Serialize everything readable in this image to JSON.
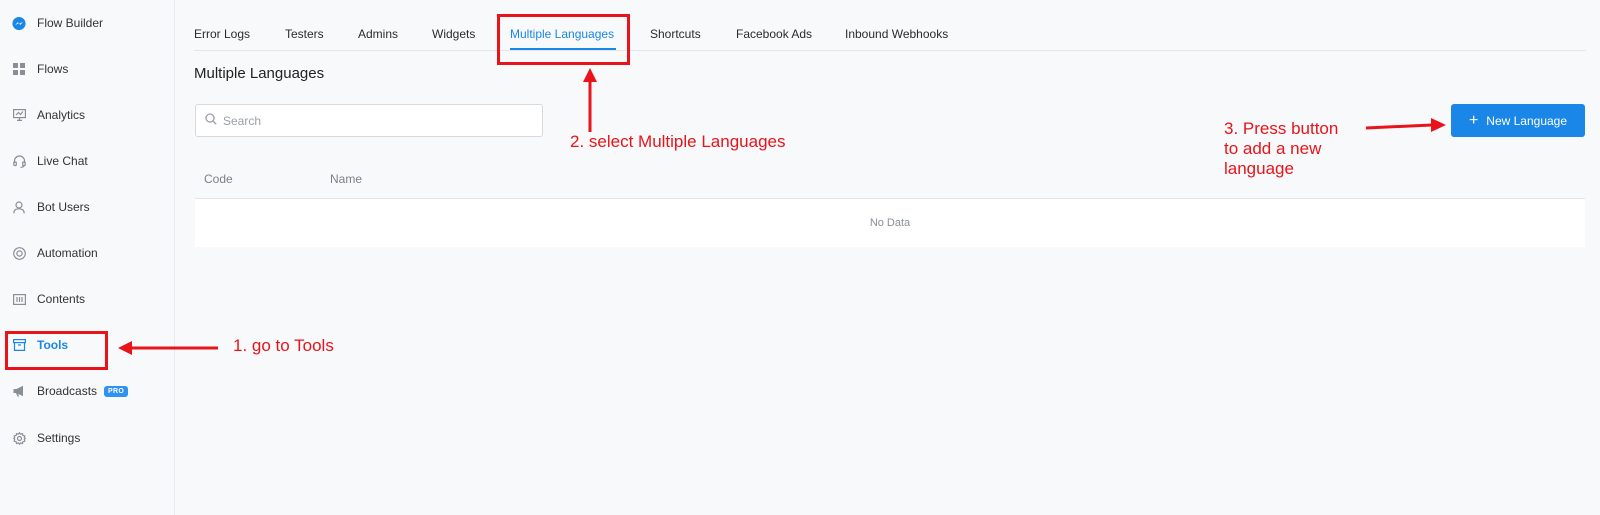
{
  "sidebar": {
    "items": [
      {
        "label": "Flow Builder",
        "icon": "messenger-icon"
      },
      {
        "label": "Flows",
        "icon": "grid-icon"
      },
      {
        "label": "Analytics",
        "icon": "chart-icon"
      },
      {
        "label": "Live Chat",
        "icon": "headset-icon"
      },
      {
        "label": "Bot Users",
        "icon": "user-icon"
      },
      {
        "label": "Automation",
        "icon": "automation-icon"
      },
      {
        "label": "Contents",
        "icon": "contents-icon"
      },
      {
        "label": "Tools",
        "icon": "toolbox-icon",
        "active": true
      },
      {
        "label": "Broadcasts",
        "icon": "megaphone-icon",
        "badge": "PRO"
      },
      {
        "label": "Settings",
        "icon": "gear-icon"
      }
    ]
  },
  "tabs": [
    {
      "label": "Error Logs"
    },
    {
      "label": "Testers"
    },
    {
      "label": "Admins"
    },
    {
      "label": "Widgets"
    },
    {
      "label": "Multiple Languages",
      "active": true
    },
    {
      "label": "Shortcuts"
    },
    {
      "label": "Facebook Ads"
    },
    {
      "label": "Inbound Webhooks"
    }
  ],
  "page": {
    "title": "Multiple Languages",
    "search_placeholder": "Search",
    "new_button_label": "New Language"
  },
  "table": {
    "columns": [
      "Code",
      "Name"
    ],
    "empty_text": "No Data"
  },
  "annotations": {
    "step1": "1. go to Tools",
    "step2": "2. select Multiple Languages",
    "step3_line1": "3. Press button",
    "step3_line2": "to add a new",
    "step3_line3": "language"
  },
  "colors": {
    "accent": "#1a86e8",
    "annotation": "#e8141a"
  }
}
